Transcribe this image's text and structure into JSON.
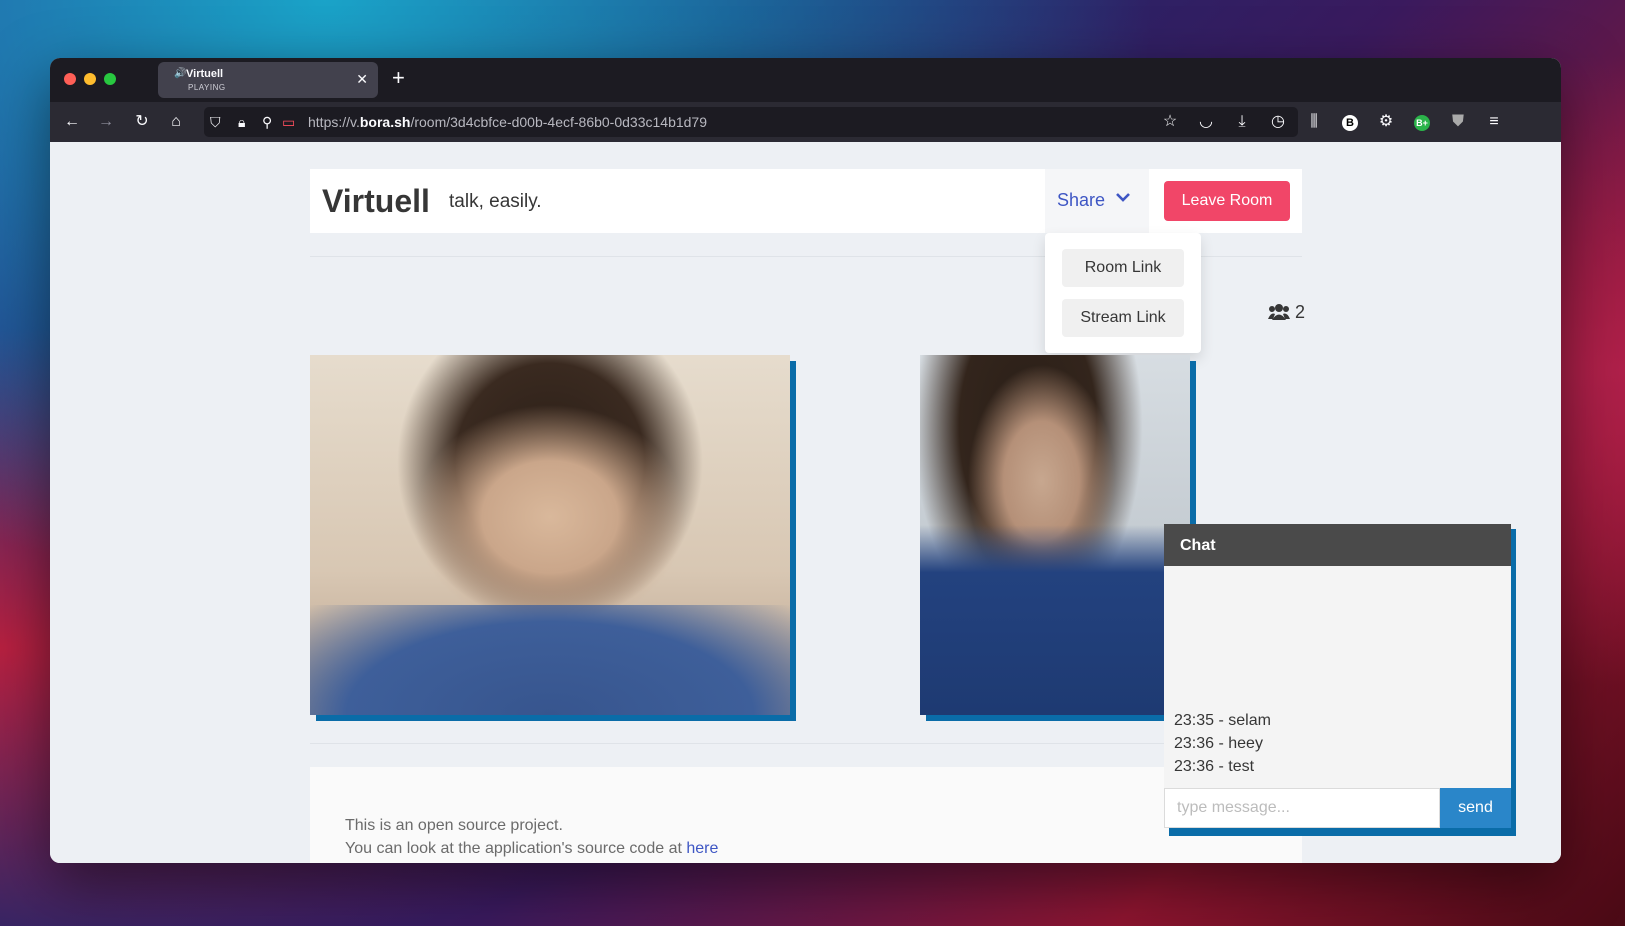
{
  "browser": {
    "tab": {
      "title": "Virtuell",
      "subtitle": "PLAYING"
    },
    "url": {
      "prefix": "https://v.",
      "domain": "bora.sh",
      "path": "/room/3d4cbfce-d00b-4ecf-86b0-0d33c14b1d79"
    }
  },
  "header": {
    "brand": "Virtuell",
    "tagline": "talk, easily.",
    "share_label": "Share",
    "leave_label": "Leave Room"
  },
  "share_menu": {
    "items": [
      "Room Link",
      "Stream Link"
    ]
  },
  "participants": {
    "count": "2"
  },
  "chat": {
    "title": "Chat",
    "messages": [
      "23:35 - selam",
      "23:36 - heey",
      "23:36 - test"
    ],
    "placeholder": "type message...",
    "send_label": "send"
  },
  "footer": {
    "line1": "This is an open source project.",
    "line2_prefix": "You can look at the application's source code at ",
    "line2_link": "here"
  },
  "colors": {
    "leave": "#f14668",
    "accent": "#3e56c4",
    "send": "#2a86c9",
    "video_border": "#0a6ca8"
  }
}
